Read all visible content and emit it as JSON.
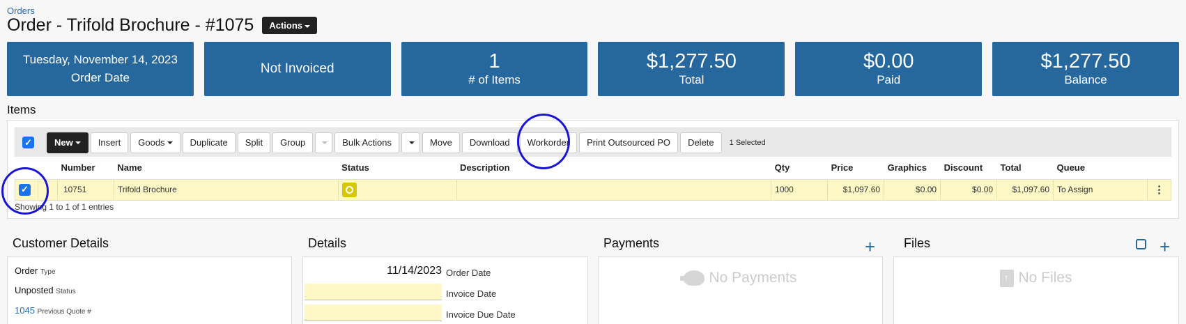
{
  "breadcrumb": "Orders",
  "title": "Order - Trifold Brochure - #1075",
  "actions_label": "Actions",
  "stats": {
    "order_date": "Tuesday, November 14, 2023",
    "order_date_label": "Order Date",
    "invoice_status": "Not Invoiced",
    "items_count": "1",
    "items_label": "# of Items",
    "total": "$1,277.50",
    "total_label": "Total",
    "paid": "$0.00",
    "paid_label": "Paid",
    "balance": "$1,277.50",
    "balance_label": "Balance"
  },
  "items_section": {
    "label": "Items",
    "toolbar": {
      "new": "New",
      "insert": "Insert",
      "goods": "Goods",
      "duplicate": "Duplicate",
      "split": "Split",
      "group": "Group",
      "bulk_actions": "Bulk Actions",
      "move": "Move",
      "download": "Download",
      "workorder": "Workorder",
      "print_po": "Print Outsourced PO",
      "delete": "Delete",
      "selected": "1 Selected"
    },
    "columns": [
      "Number",
      "Name",
      "Status",
      "Description",
      "Qty",
      "Price",
      "Graphics",
      "Discount",
      "Total",
      "Queue"
    ],
    "row": {
      "number": "10751",
      "name": "Trifold Brochure",
      "description": "",
      "qty": "1000",
      "price": "$1,097.60",
      "graphics": "$0.00",
      "discount": "$0.00",
      "total": "$1,097.60",
      "queue": "To Assign"
    },
    "showing": "Showing 1 to 1 of 1 entries"
  },
  "customer_details": {
    "title": "Customer Details",
    "type_value": "Order",
    "type_label": "Type",
    "status_value": "Unposted",
    "status_label": "Status",
    "quote_value": "1045",
    "quote_label": "Previous Quote #"
  },
  "details": {
    "title": "Details",
    "order_date": "11/14/2023",
    "order_date_label": "Order Date",
    "invoice_date_label": "Invoice Date",
    "invoice_due_label": "Invoice Due Date"
  },
  "payments": {
    "title": "Payments",
    "empty": "No Payments"
  },
  "files": {
    "title": "Files",
    "empty": "No Files"
  },
  "colors": {
    "stat_bg": "#26679e",
    "highlight_circle": "#1a14d6",
    "row_bg": "#fdf8c5",
    "status_icon": "#d7c800"
  }
}
